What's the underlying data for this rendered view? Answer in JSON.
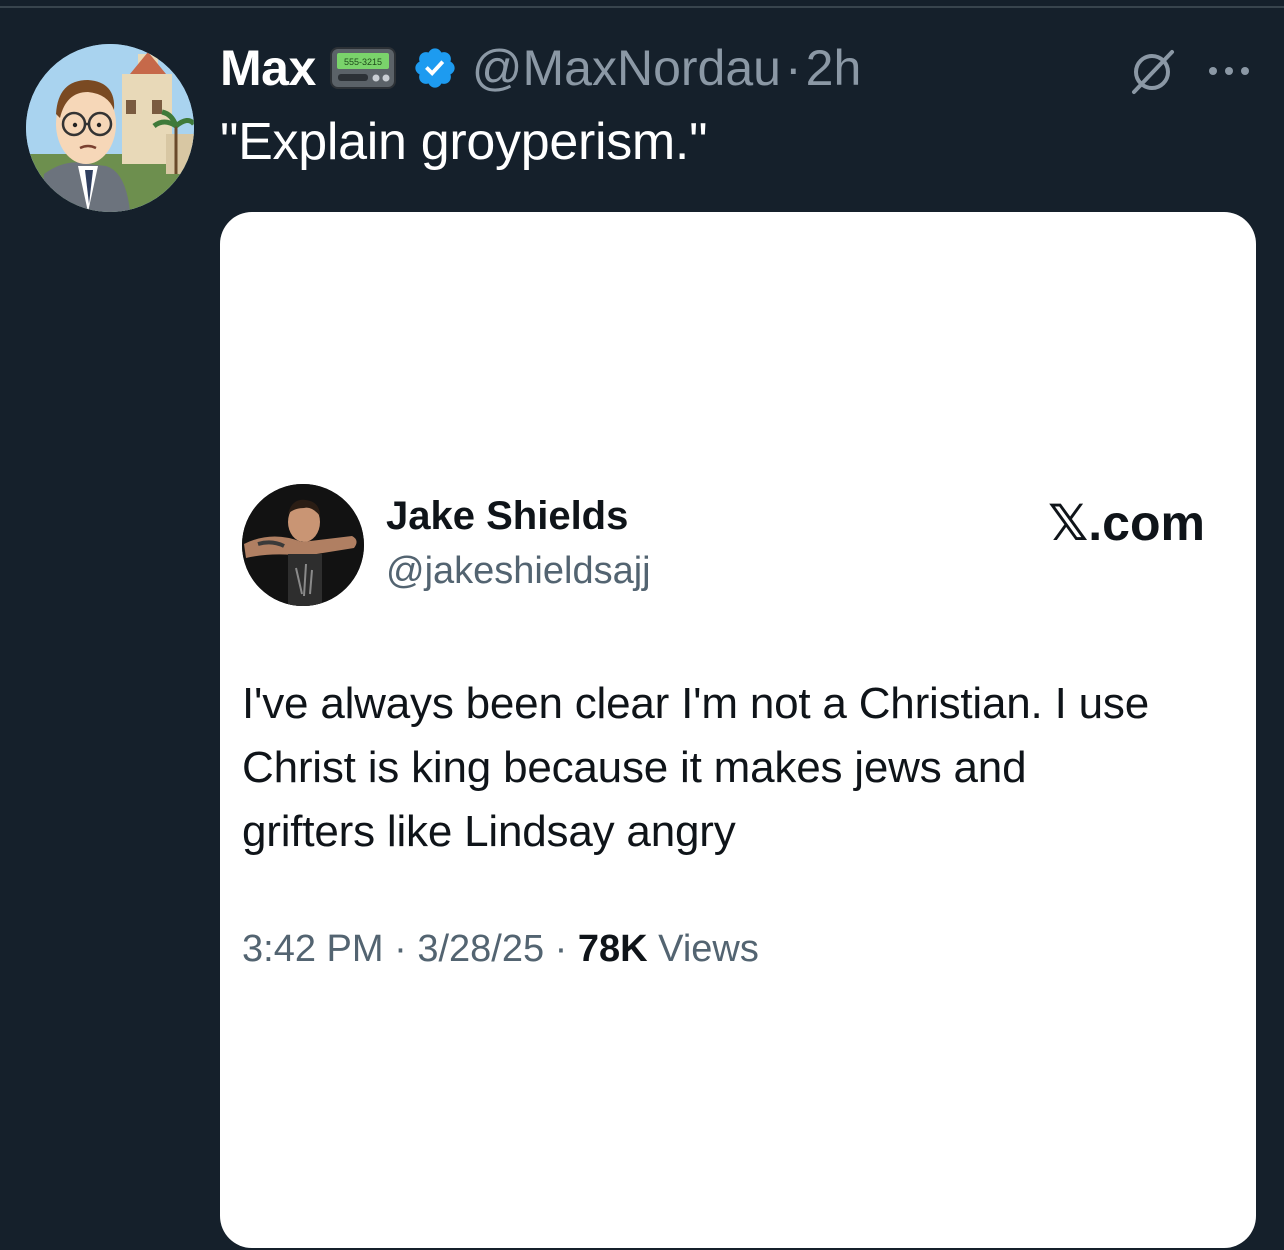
{
  "post": {
    "author_name": "Max",
    "pager_text": "555-3215",
    "handle": "@MaxNordau",
    "separator": "·",
    "time": "2h",
    "text": "\"Explain groyperism.\"",
    "icons": {
      "avatar": "cartoon-avatar",
      "pager": "pager-emoji-icon",
      "verified": "verified-badge-icon",
      "grok": "grok-icon",
      "more": "more-options-icon"
    }
  },
  "embedded_tweet": {
    "author_name": "Jake Shields",
    "handle": "@jakeshieldsajj",
    "site_label": "𝕏.com",
    "body_lines": [
      "I've always been clear I'm not a Christian.   I use",
      "Christ is king because it makes jews and",
      "grifters like Lindsay angry"
    ],
    "time": "3:42 PM",
    "date": "3/28/25",
    "separator": "·",
    "views_count": "78K",
    "views_label": "Views"
  },
  "colors": {
    "background": "#15202b",
    "verified_blue": "#1d9bf0",
    "muted_text": "#8b98a5"
  }
}
